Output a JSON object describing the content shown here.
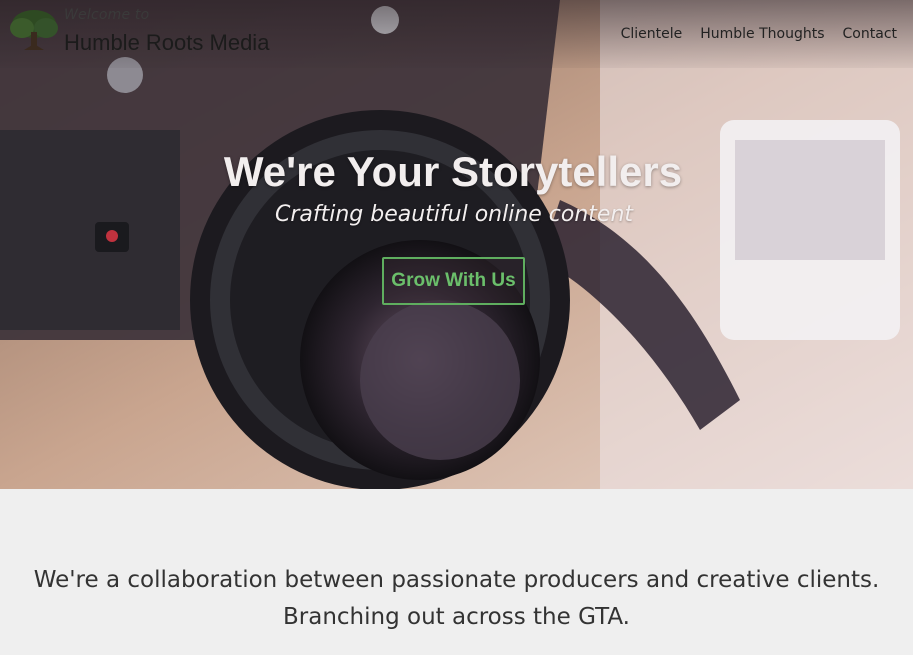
{
  "header": {
    "welcome": "Welcome to",
    "brand": "Humble Roots Media",
    "logo_icon": "tree-icon",
    "nav": [
      {
        "label": "Clientele"
      },
      {
        "label": "Humble Thoughts"
      },
      {
        "label": "Contact"
      }
    ]
  },
  "hero": {
    "title": "We're Your Storytellers",
    "subtitle": "Crafting beautiful online content",
    "cta_label": "Grow With Us",
    "background": "camera-photo"
  },
  "intro": {
    "line1": "We're a collaboration between passionate producers and creative clients.",
    "line2": "Branching out across the GTA."
  },
  "colors": {
    "accent": "#5fae5f",
    "hero_text": "#f2eeee",
    "page_bg": "#efefef",
    "body_text": "#333333"
  }
}
